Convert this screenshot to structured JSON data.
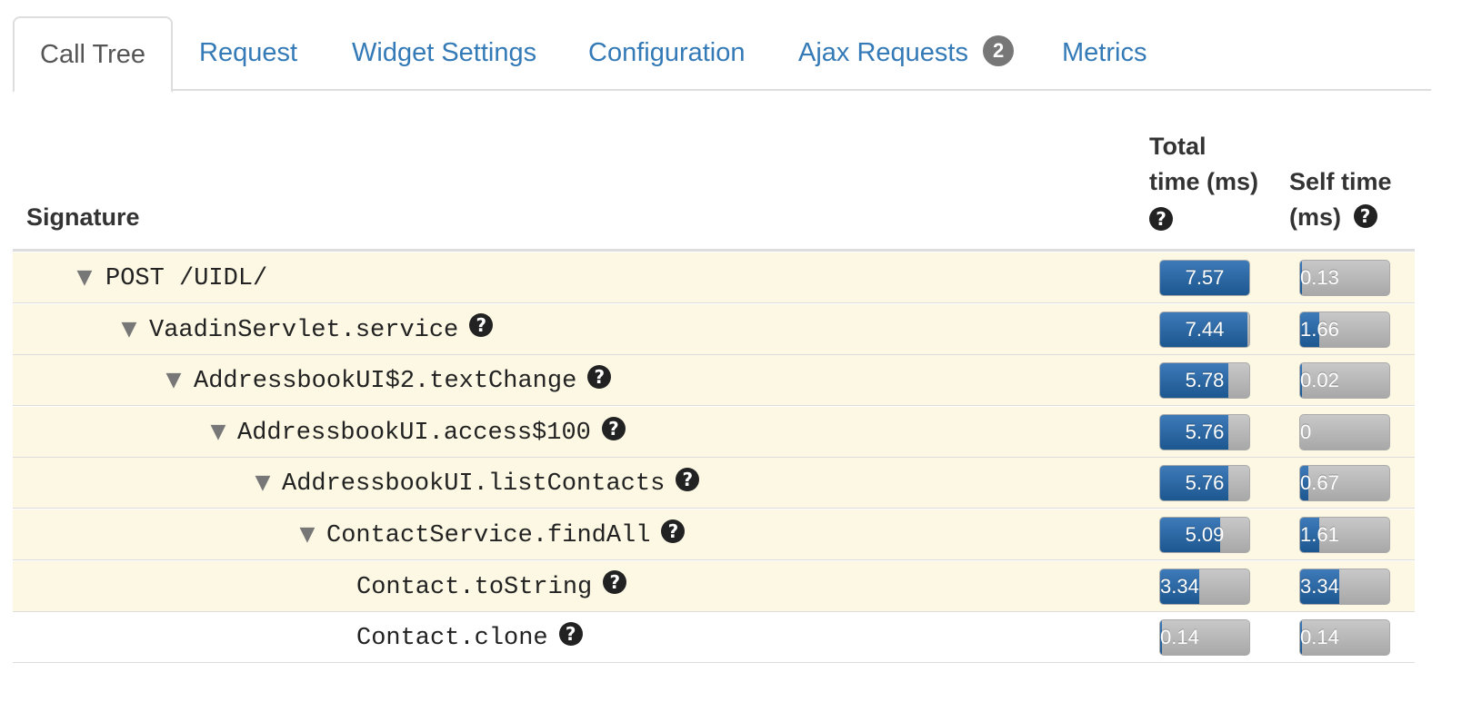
{
  "tabs": [
    {
      "label": "Call Tree",
      "active": true
    },
    {
      "label": "Request"
    },
    {
      "label": "Widget Settings"
    },
    {
      "label": "Configuration"
    },
    {
      "label": "Ajax Requests",
      "badge": "2"
    },
    {
      "label": "Metrics"
    }
  ],
  "table": {
    "headers": {
      "signature": "Signature",
      "total_time_line1": "Total",
      "total_time_line2": "time (ms)",
      "self_time_line1": "Self time",
      "self_time_line2": "(ms)"
    },
    "rows": [
      {
        "signature": "POST /UIDL/",
        "total": "7.57",
        "self": "0.13",
        "total_fraction": 1.0,
        "self_fraction": 0.017,
        "expandable": true,
        "help": false
      },
      {
        "signature": "VaadinServlet.service",
        "total": "7.44",
        "self": "1.66",
        "total_fraction": 0.983,
        "self_fraction": 0.219,
        "expandable": true,
        "help": true
      },
      {
        "signature": "AddressbookUI$2.textChange",
        "total": "5.78",
        "self": "0.02",
        "total_fraction": 0.764,
        "self_fraction": 0.003,
        "expandable": true,
        "help": true
      },
      {
        "signature": "AddressbookUI.access$100",
        "total": "5.76",
        "self": "0",
        "total_fraction": 0.761,
        "self_fraction": 0.0,
        "expandable": true,
        "help": true
      },
      {
        "signature": "AddressbookUI.listContacts",
        "total": "5.76",
        "self": "0.67",
        "total_fraction": 0.761,
        "self_fraction": 0.088,
        "expandable": true,
        "help": true
      },
      {
        "signature": "ContactService.findAll",
        "total": "5.09",
        "self": "1.61",
        "total_fraction": 0.672,
        "self_fraction": 0.213,
        "expandable": true,
        "help": true
      },
      {
        "signature": "Contact.toString",
        "total": "3.34",
        "self": "3.34",
        "total_fraction": 0.441,
        "self_fraction": 0.441,
        "expandable": false,
        "help": true
      },
      {
        "signature": "Contact.clone",
        "total": "0.14",
        "self": "0.14",
        "total_fraction": 0.018,
        "self_fraction": 0.018,
        "expandable": false,
        "help": true
      }
    ]
  },
  "icons": {
    "help": "question-circle-icon",
    "expand": "caret-down-icon"
  },
  "colors": {
    "link": "#337ab7",
    "row_highlight": "#fcf8e3",
    "bar_fill": "#2a679f",
    "bar_track": "#b8b8b8",
    "badge": "#777777"
  }
}
